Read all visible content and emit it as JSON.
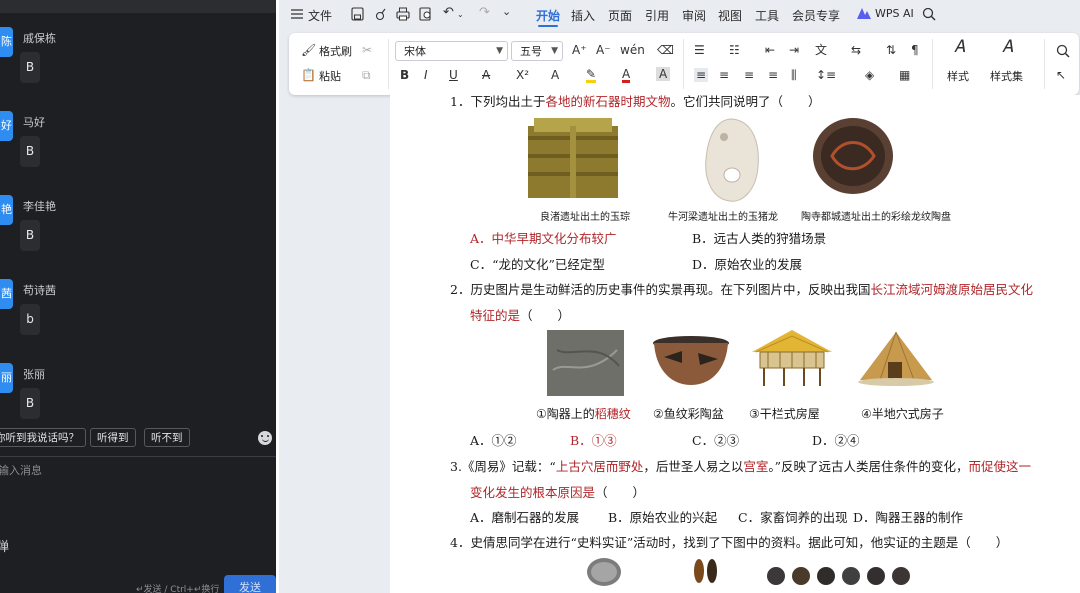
{
  "chat": {
    "members": [
      {
        "avatar": "陈",
        "name": "戚保栋",
        "message": "B"
      },
      {
        "avatar": "好",
        "name": "马好",
        "message": "B"
      },
      {
        "avatar": "艳",
        "name": "李佳艳",
        "message": "B"
      },
      {
        "avatar": "茜",
        "name": "苟诗茜",
        "message": "b"
      },
      {
        "avatar": "丽",
        "name": "张丽",
        "message": "B"
      }
    ],
    "quick_replies": [
      "你听到我说话吗？",
      "听得到",
      "听不到"
    ],
    "input_placeholder": "输入消息",
    "barrage_label": "弹",
    "send_hint": "↵发送 / Ctrl+↵换行",
    "send_button": "发送"
  },
  "wps": {
    "menu": {
      "file": "文件",
      "tabs": [
        "开始",
        "插入",
        "页面",
        "引用",
        "审阅",
        "视图",
        "工具",
        "会员专享"
      ],
      "active_tab": "开始",
      "ai": "WPS AI"
    },
    "ribbon": {
      "format_painter": "格式刷",
      "paste": "粘贴",
      "font_name": "宋体",
      "font_size": "五号",
      "styles": "样式",
      "style_set": "样式集"
    },
    "doc": {
      "q1": {
        "stem_pre": "1．下列均出土于",
        "stem_red": "各地的新石器时期文物",
        "stem_post": "。它们共同说明了（　　）",
        "captions": [
          "良渚遗址出土的玉琮",
          "牛河梁遗址出土的玉猪龙",
          "陶寺都城遗址出土的彩绘龙纹陶盘"
        ],
        "a": "A．中华早期文化分布较广",
        "b": "B．远古人类的狩猎场景",
        "c": "C．“龙的文化”已经定型",
        "d": "D．原始农业的发展"
      },
      "q2": {
        "stem_pre": "2．历史图片是生动鲜活的历史事件的实景再现。在下列图片中，反映出我国",
        "stem_red": "长江流域河姆渡原始居民文化",
        "line2_red": "特征的是",
        "line2_post": "（　　）",
        "captions": [
          "①陶器上的",
          "稻穗纹",
          "②鱼纹彩陶盆",
          "③干栏式房屋",
          "④半地穴式房子"
        ],
        "a": "A．①②",
        "b": "B．①③",
        "c": "C．②③",
        "d": "D．②④"
      },
      "q3": {
        "s1": "3.《周易》记载：“",
        "s2": "上古穴居而野处",
        "s3": "，后世圣人易之以",
        "s4": "宫室",
        "s5": "。”反映了远古人类居住条件的变化，",
        "s6": "而促使这一",
        "line2_red": "变化发生的根本原因是",
        "line2_post": "（　　）",
        "a": "A．磨制石器的发展",
        "b": "B．原始农业的兴起",
        "c": "C．家畜饲养的出现",
        "d": "D．陶器王器的制作"
      },
      "q4": {
        "stem": "4．史倩思同学在进行“史料实证”活动时，找到了下图中的资料。据此可知，他实证的主题是（　　）"
      }
    }
  }
}
